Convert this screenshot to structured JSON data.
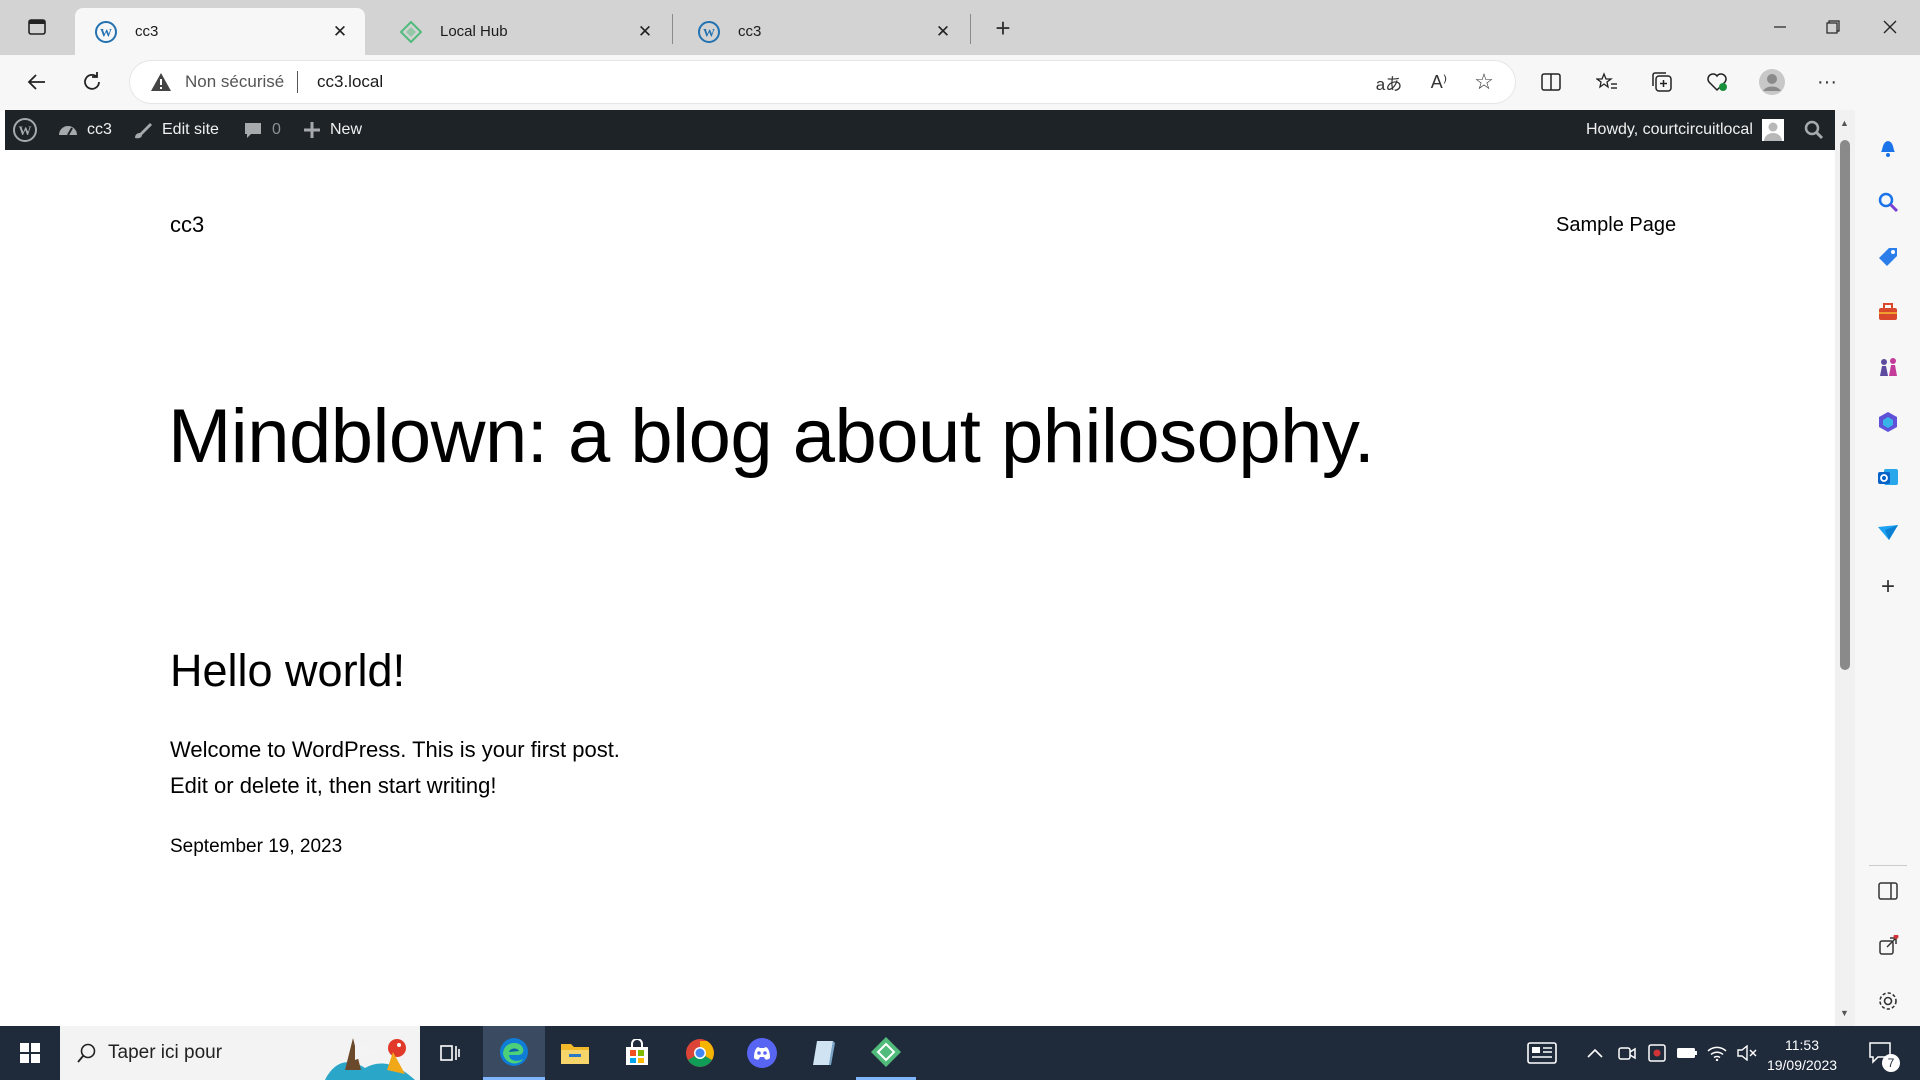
{
  "browser": {
    "tabs": [
      {
        "title": "cc3",
        "active": true,
        "icon": "wordpress-icon"
      },
      {
        "title": "Local Hub",
        "active": false,
        "icon": "local-icon"
      },
      {
        "title": "cc3",
        "active": false,
        "icon": "wordpress-icon"
      }
    ],
    "address": {
      "security_label": "Non sécurisé",
      "url": "cc3.local"
    }
  },
  "admin_bar": {
    "site_name": "cc3",
    "edit_site": "Edit site",
    "comments_count": "0",
    "new_label": "New",
    "howdy": "Howdy, courtcircuitlocal"
  },
  "site": {
    "title": "cc3",
    "nav": [
      "Sample Page"
    ],
    "tagline": "Mindblown: a blog about philosophy."
  },
  "post": {
    "title": "Hello world!",
    "excerpt_line1": "Welcome to WordPress. This is your first post.",
    "excerpt_line2": "Edit or delete it, then start writing!",
    "date": "September 19, 2023"
  },
  "taskbar": {
    "search_placeholder": "Taper ici pour",
    "time": "11:53",
    "date": "19/09/2023",
    "notifications": "7"
  },
  "colors": {
    "admin_bar": "#1d2327",
    "taskbar": "#1f2a3a",
    "tabstrip": "#d3d3d3",
    "toolbar": "#f7f7f7"
  }
}
